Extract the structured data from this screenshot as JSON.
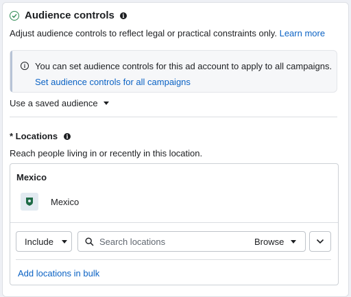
{
  "audience_controls": {
    "title": "Audience controls",
    "description": "Adjust audience controls to reflect legal or practical constraints only.",
    "learn_more": "Learn more"
  },
  "info_box": {
    "message": "You can set audience controls for this ad account to apply to all campaigns.",
    "link": "Set audience controls for all campaigns"
  },
  "saved_audience": {
    "label": "Use a saved audience"
  },
  "locations": {
    "title": "* Locations",
    "description": "Reach people living in or recently in this location.",
    "country_heading": "Mexico",
    "items": [
      {
        "label": "Mexico"
      }
    ],
    "include_label": "Include",
    "search_placeholder": "Search locations",
    "browse_label": "Browse",
    "bulk_link": "Add locations in bulk"
  },
  "colors": {
    "link": "#0a62c4",
    "check": "#2f8a54",
    "pin": "#1f6b46"
  }
}
